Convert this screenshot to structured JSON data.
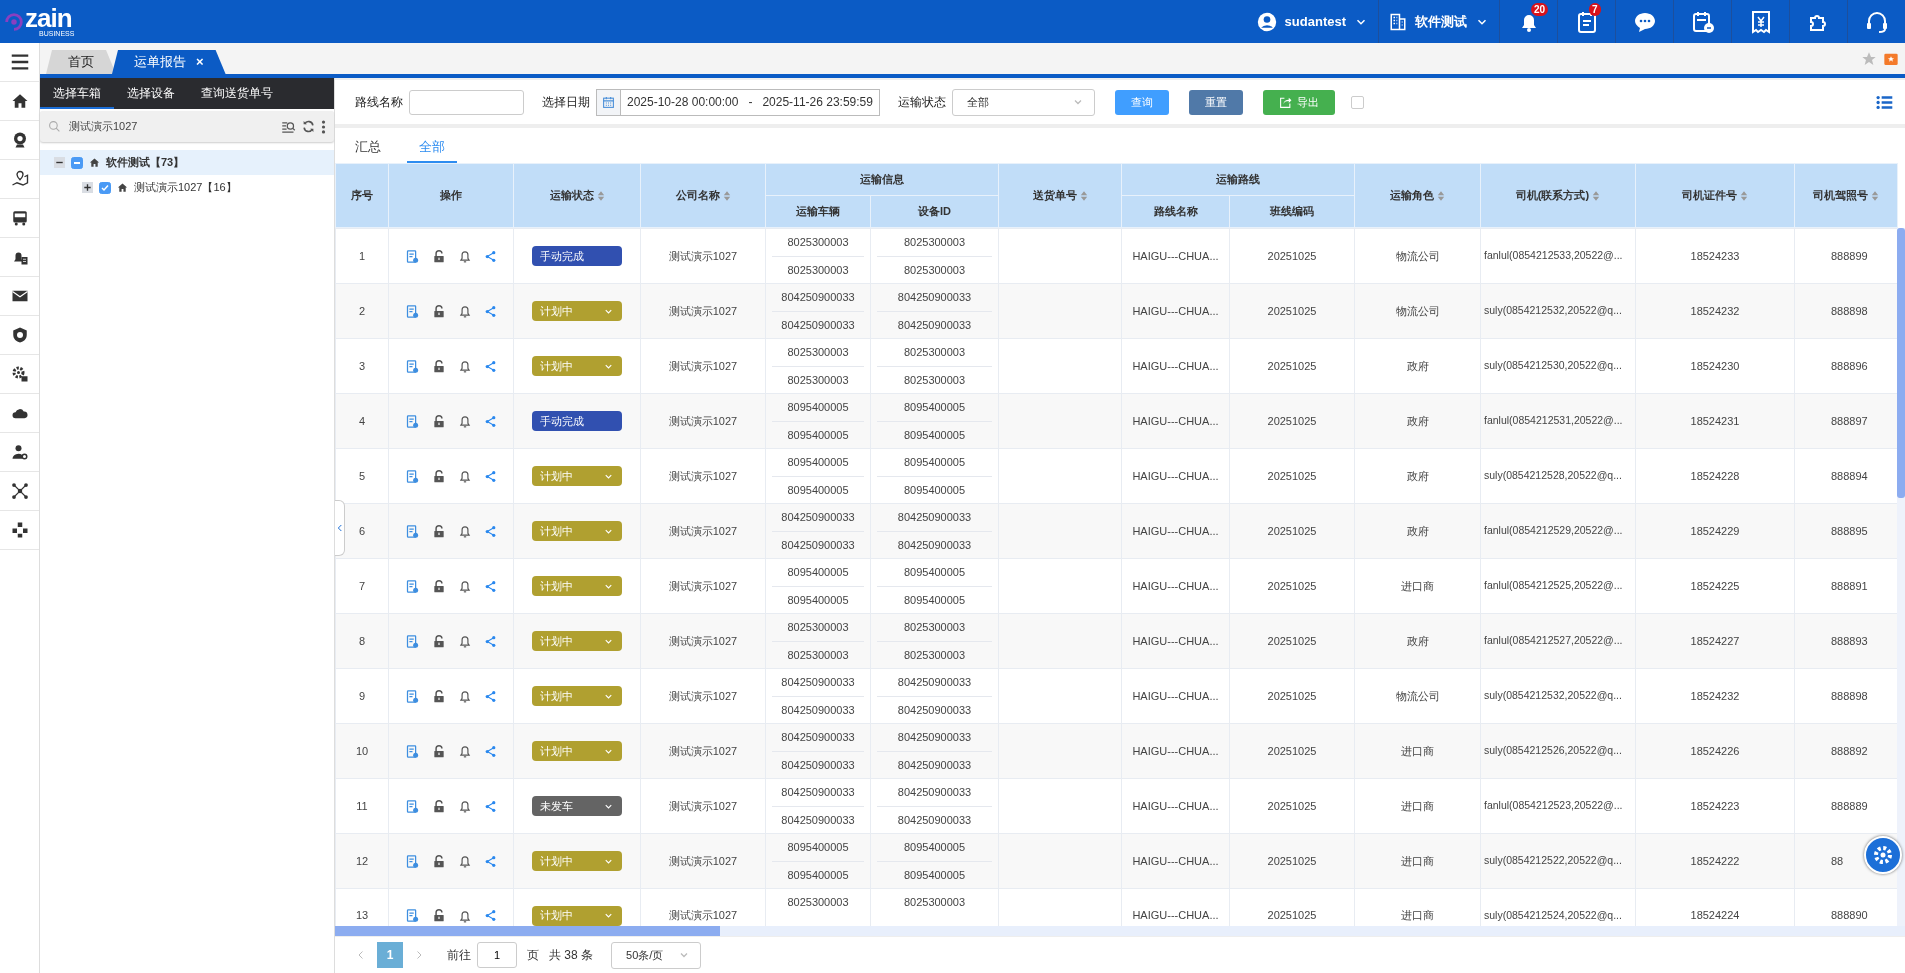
{
  "header": {
    "logo": {
      "name": "zain",
      "tagline": "BUSINESS"
    },
    "user": "sudantest",
    "org": "软件测试",
    "tools": [
      {
        "kind": "bell",
        "badge": "20"
      },
      {
        "kind": "tasks",
        "badge": "7"
      },
      {
        "kind": "chat"
      },
      {
        "kind": "calendar"
      },
      {
        "kind": "receipt"
      },
      {
        "kind": "puzzle"
      },
      {
        "kind": "headset"
      }
    ]
  },
  "nav_rail": [
    {
      "kind": "menu"
    },
    {
      "kind": "home"
    },
    {
      "kind": "camera"
    },
    {
      "kind": "map"
    },
    {
      "kind": "bus"
    },
    {
      "kind": "alert"
    },
    {
      "kind": "mail"
    },
    {
      "kind": "shield"
    },
    {
      "kind": "settings"
    },
    {
      "kind": "cloud"
    },
    {
      "kind": "user"
    },
    {
      "kind": "network"
    },
    {
      "kind": "nodes"
    }
  ],
  "page_tabs": [
    {
      "label": "首页",
      "selected": false
    },
    {
      "label": "运单报告",
      "selected": true,
      "close": "×"
    }
  ],
  "left_panel": {
    "tabs": [
      {
        "label": "选择车箱",
        "selected": true
      },
      {
        "label": "选择设备",
        "selected": false
      },
      {
        "label": "查询送货单号",
        "selected": false
      }
    ],
    "search": {
      "value": "测试演示1027"
    },
    "tree": [
      {
        "label": "软件测试【73】",
        "checked": true,
        "partial": true,
        "expanded": true,
        "selected": true,
        "children": [
          {
            "label": "测试演示1027【16】",
            "checked": true,
            "partial": false,
            "expanded": false,
            "selected": false
          }
        ]
      }
    ]
  },
  "filters": {
    "route": {
      "label": "路线名称"
    },
    "date": {
      "label": "选择日期",
      "from": "2025-10-28 00:00:00",
      "separator": "-",
      "to": "2025-11-26 23:59:59"
    },
    "status": {
      "label": "运输状态",
      "value": "全部"
    },
    "buttons": [
      {
        "label": "查询",
        "kind": "primary"
      },
      {
        "label": "重置",
        "kind": "secondary"
      },
      {
        "label": "导出",
        "kind": "export"
      }
    ],
    "option_checked": false
  },
  "view_tabs": [
    {
      "label": "汇总",
      "selected": false
    },
    {
      "label": "全部",
      "selected": true
    }
  ],
  "table": {
    "columns": [
      {
        "label": "序号",
        "sortable": false
      },
      {
        "label": "操作",
        "sortable": false
      },
      {
        "label": "运输状态",
        "sortable": true
      },
      {
        "label": "公司名称",
        "sortable": true
      },
      {
        "group": "运输信息",
        "children": [
          {
            "label": "运输车辆"
          },
          {
            "label": "设备ID"
          }
        ]
      },
      {
        "label": "送货单号",
        "sortable": true
      },
      {
        "group": "运输路线",
        "children": [
          {
            "label": "路线名称"
          },
          {
            "label": "班线编码"
          }
        ]
      },
      {
        "label": "运输角色",
        "sortable": true
      },
      {
        "label": "司机(联系方式)",
        "sortable": true
      },
      {
        "label": "司机证件号",
        "sortable": true
      },
      {
        "label": "司机驾照号",
        "sortable": true
      }
    ],
    "rows": [
      {
        "no": "1",
        "status": {
          "label": "手动完成",
          "kind": "done"
        },
        "company": "测试演示1027",
        "vehicles": [
          "8025300003",
          "8025300003"
        ],
        "devices": [
          "8025300003",
          "8025300003"
        ],
        "route": "HAIGU---CHUA...",
        "line_code": "20251025",
        "role": "物流公司",
        "driver": "fanlul(0854212533,20522@...",
        "driver_id": "18524233",
        "license": "888899"
      },
      {
        "no": "2",
        "status": {
          "label": "计划中",
          "kind": "planned"
        },
        "company": "测试演示1027",
        "vehicles": [
          "804250900033",
          "804250900033"
        ],
        "devices": [
          "804250900033",
          "804250900033"
        ],
        "route": "HAIGU---CHUA...",
        "line_code": "20251025",
        "role": "物流公司",
        "driver": "suly(0854212532,20522@q...",
        "driver_id": "18524232",
        "license": "888898"
      },
      {
        "no": "3",
        "status": {
          "label": "计划中",
          "kind": "planned"
        },
        "company": "测试演示1027",
        "vehicles": [
          "8025300003",
          "8025300003"
        ],
        "devices": [
          "8025300003",
          "8025300003"
        ],
        "route": "HAIGU---CHUA...",
        "line_code": "20251025",
        "role": "政府",
        "driver": "suly(0854212530,20522@q...",
        "driver_id": "18524230",
        "license": "888896"
      },
      {
        "no": "4",
        "status": {
          "label": "手动完成",
          "kind": "done"
        },
        "company": "测试演示1027",
        "vehicles": [
          "8095400005",
          "8095400005"
        ],
        "devices": [
          "8095400005",
          "8095400005"
        ],
        "route": "HAIGU---CHUA...",
        "line_code": "20251025",
        "role": "政府",
        "driver": "fanlul(0854212531,20522@...",
        "driver_id": "18524231",
        "license": "888897"
      },
      {
        "no": "5",
        "status": {
          "label": "计划中",
          "kind": "planned"
        },
        "company": "测试演示1027",
        "vehicles": [
          "8095400005",
          "8095400005"
        ],
        "devices": [
          "8095400005",
          "8095400005"
        ],
        "route": "HAIGU---CHUA...",
        "line_code": "20251025",
        "role": "政府",
        "driver": "suly(0854212528,20522@q...",
        "driver_id": "18524228",
        "license": "888894"
      },
      {
        "no": "6",
        "status": {
          "label": "计划中",
          "kind": "planned"
        },
        "company": "测试演示1027",
        "vehicles": [
          "804250900033",
          "804250900033"
        ],
        "devices": [
          "804250900033",
          "804250900033"
        ],
        "route": "HAIGU---CHUA...",
        "line_code": "20251025",
        "role": "政府",
        "driver": "fanlul(0854212529,20522@...",
        "driver_id": "18524229",
        "license": "888895"
      },
      {
        "no": "7",
        "status": {
          "label": "计划中",
          "kind": "planned"
        },
        "company": "测试演示1027",
        "vehicles": [
          "8095400005",
          "8095400005"
        ],
        "devices": [
          "8095400005",
          "8095400005"
        ],
        "route": "HAIGU---CHUA...",
        "line_code": "20251025",
        "role": "进口商",
        "driver": "fanlul(0854212525,20522@...",
        "driver_id": "18524225",
        "license": "888891"
      },
      {
        "no": "8",
        "status": {
          "label": "计划中",
          "kind": "planned"
        },
        "company": "测试演示1027",
        "vehicles": [
          "8025300003",
          "8025300003"
        ],
        "devices": [
          "8025300003",
          "8025300003"
        ],
        "route": "HAIGU---CHUA...",
        "line_code": "20251025",
        "role": "政府",
        "driver": "fanlul(0854212527,20522@...",
        "driver_id": "18524227",
        "license": "888893"
      },
      {
        "no": "9",
        "status": {
          "label": "计划中",
          "kind": "planned"
        },
        "company": "测试演示1027",
        "vehicles": [
          "804250900033",
          "804250900033"
        ],
        "devices": [
          "804250900033",
          "804250900033"
        ],
        "route": "HAIGU---CHUA...",
        "line_code": "20251025",
        "role": "物流公司",
        "driver": "suly(0854212532,20522@q...",
        "driver_id": "18524232",
        "license": "888898"
      },
      {
        "no": "10",
        "status": {
          "label": "计划中",
          "kind": "planned"
        },
        "company": "测试演示1027",
        "vehicles": [
          "804250900033",
          "804250900033"
        ],
        "devices": [
          "804250900033",
          "804250900033"
        ],
        "route": "HAIGU---CHUA...",
        "line_code": "20251025",
        "role": "进口商",
        "driver": "suly(0854212526,20522@q...",
        "driver_id": "18524226",
        "license": "888892"
      },
      {
        "no": "11",
        "status": {
          "label": "未发车",
          "kind": "pending"
        },
        "company": "测试演示1027",
        "vehicles": [
          "804250900033",
          "804250900033"
        ],
        "devices": [
          "804250900033",
          "804250900033"
        ],
        "route": "HAIGU---CHUA...",
        "line_code": "20251025",
        "role": "进口商",
        "driver": "fanlul(0854212523,20522@...",
        "driver_id": "18524223",
        "license": "888889"
      },
      {
        "no": "12",
        "status": {
          "label": "计划中",
          "kind": "planned"
        },
        "company": "测试演示1027",
        "vehicles": [
          "8095400005",
          "8095400005"
        ],
        "devices": [
          "8095400005",
          "8095400005"
        ],
        "route": "HAIGU---CHUA...",
        "line_code": "20251025",
        "role": "进口商",
        "driver": "suly(0854212522,20522@q...",
        "driver_id": "18524222",
        "license": "88"
      },
      {
        "no": "13",
        "status": {
          "label": "计划中",
          "kind": "planned"
        },
        "company": "测试演示1027",
        "vehicles": [
          "8025300003"
        ],
        "devices": [
          "8025300003"
        ],
        "route": "HAIGU---CHUA...",
        "line_code": "20251025",
        "role": "进口商",
        "driver": "suly(0854212524,20522@q...",
        "driver_id": "18524224",
        "license": "888890"
      }
    ]
  },
  "pagination": {
    "pages": [
      {
        "label": "1",
        "selected": true
      }
    ],
    "goto_label": "前往",
    "goto_value": "1",
    "page_unit": "页",
    "total": "共 38 条",
    "page_size": "50条/页"
  }
}
